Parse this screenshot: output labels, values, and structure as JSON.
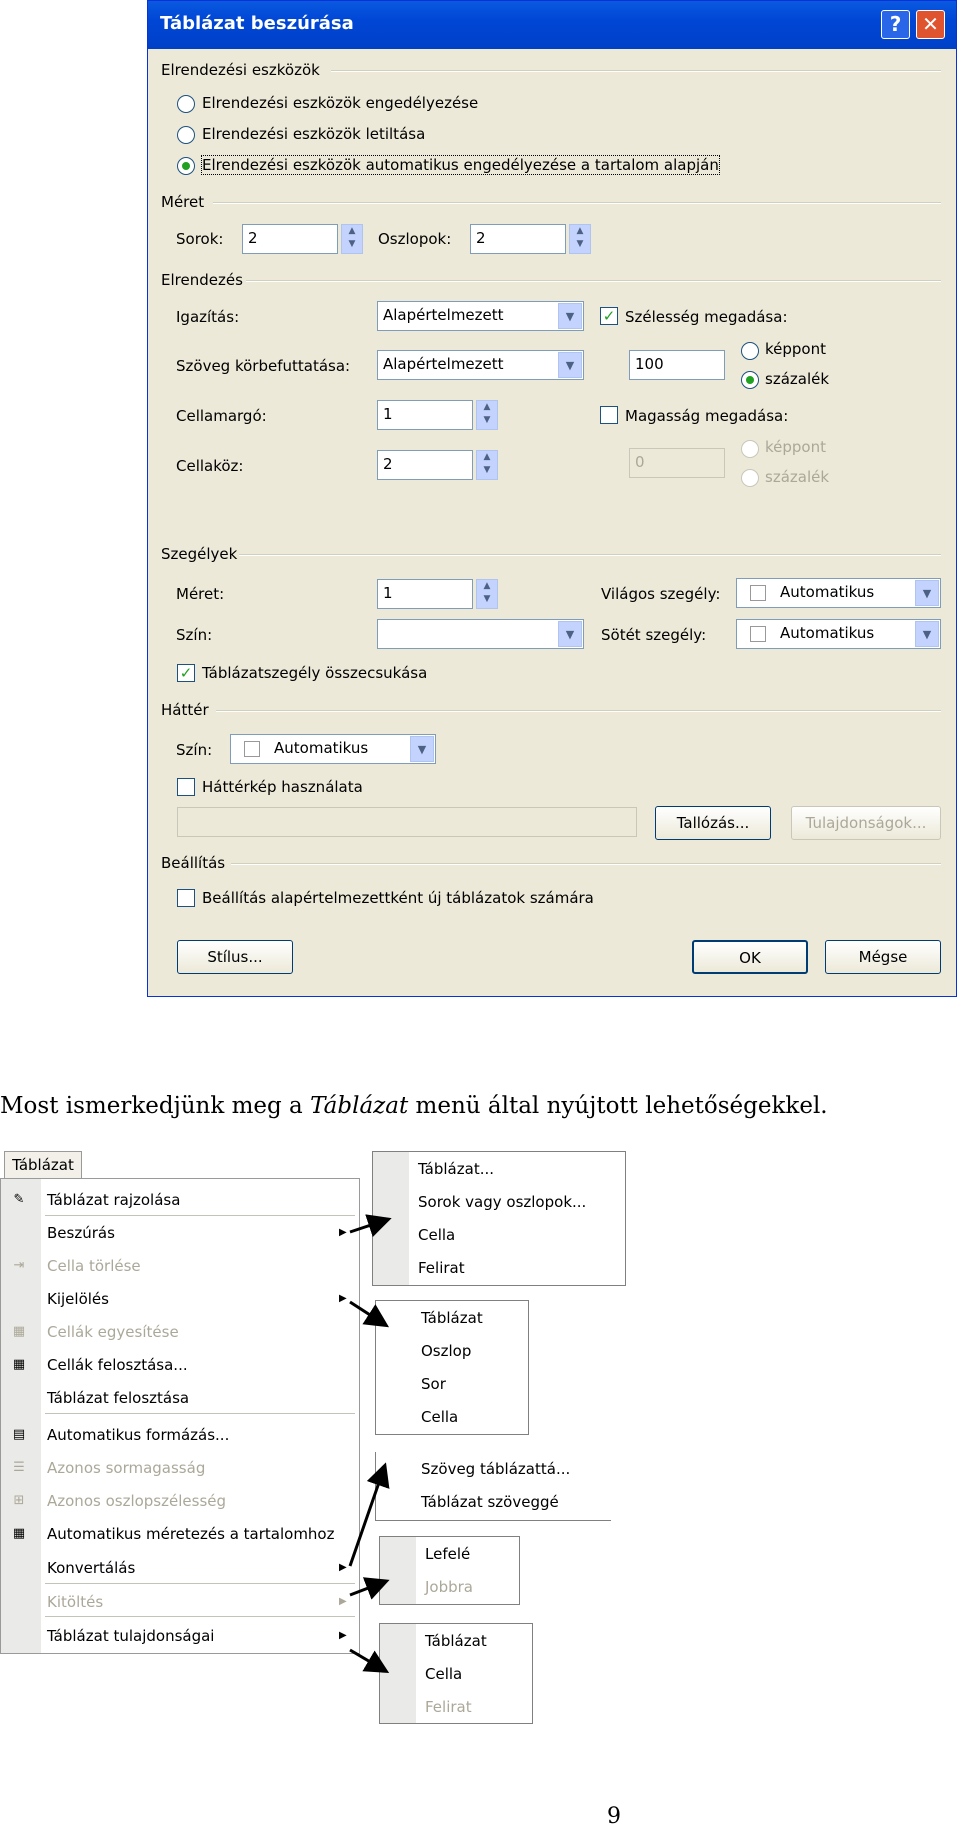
{
  "dialog": {
    "title": "Táblázat beszúrása",
    "help": "?",
    "close": "✕",
    "layout_tools": {
      "heading": "Elrendezési eszközök",
      "options": [
        "Elrendezési eszközök engedélyezése",
        "Elrendezési eszközök letiltása",
        "Elrendezési eszközök automatikus engedélyezése a tartalom alapján"
      ],
      "selected": 2
    },
    "size": {
      "heading": "Méret",
      "rows_label": "Sorok:",
      "rows_value": "2",
      "cols_label": "Oszlopok:",
      "cols_value": "2"
    },
    "layout": {
      "heading": "Elrendezés",
      "align_label": "Igazítás:",
      "align_value": "Alapértelmezett",
      "wrap_label": "Szöveg körbefuttatása:",
      "wrap_value": "Alapértelmezett",
      "padding_label": "Cellamargó:",
      "padding_value": "1",
      "spacing_label": "Cellaköz:",
      "spacing_value": "2",
      "width_label": "Szélesség megadása:",
      "width_checked": true,
      "width_value": "100",
      "width_unit1": "képpont",
      "width_unit2": "százalék",
      "width_unit_selected": 2,
      "height_label": "Magasság megadása:",
      "height_checked": false,
      "height_value": "0",
      "height_unit1": "képpont",
      "height_unit2": "százalék"
    },
    "borders": {
      "heading": "Szegélyek",
      "size_label": "Méret:",
      "size_value": "1",
      "color_label": "Szín:",
      "color_value": "",
      "light_label": "Világos szegély:",
      "light_value": "Automatikus",
      "dark_label": "Sötét szegély:",
      "dark_value": "Automatikus",
      "collapse_label": "Táblázatszegély összecsukása",
      "collapse_checked": true
    },
    "background": {
      "heading": "Háttér",
      "color_label": "Szín:",
      "color_value": "Automatikus",
      "image_label": "Háttérkép használata",
      "image_checked": false,
      "path_value": "",
      "browse": "Tallózás...",
      "properties": "Tulajdonságok..."
    },
    "settings": {
      "heading": "Beállítás",
      "default_label": "Beállítás alapértelmezettként új táblázatok számára",
      "default_checked": false
    },
    "style_btn": "Stílus...",
    "ok_btn": "OK",
    "cancel_btn": "Mégse"
  },
  "caption": {
    "before": "Most ismerkedjünk meg a ",
    "italic": "Táblázat",
    "after": " menü által nyújtott lehetőségekkel."
  },
  "menu": {
    "title": "Táblázat",
    "items": [
      {
        "label": "Táblázat rajzolása",
        "icon": "pencil-icon",
        "glyph": "✎",
        "disabled": false,
        "sub": false
      },
      {
        "label": "Beszúrás",
        "icon": "",
        "glyph": "",
        "disabled": false,
        "sub": true
      },
      {
        "label": "Cella törlése",
        "icon": "delete-cells-icon",
        "glyph": "⇥",
        "disabled": true,
        "sub": false
      },
      {
        "label": "Kijelölés",
        "icon": "",
        "glyph": "",
        "disabled": false,
        "sub": true
      },
      {
        "label": "Cellák egyesítése",
        "icon": "merge-cells-icon",
        "glyph": "▦",
        "disabled": true,
        "sub": false
      },
      {
        "label": "Cellák felosztása...",
        "icon": "split-cells-icon",
        "glyph": "▦",
        "disabled": false,
        "sub": false
      },
      {
        "label": "Táblázat felosztása",
        "icon": "",
        "glyph": "",
        "disabled": false,
        "sub": false
      },
      {
        "label": "Automatikus formázás...",
        "icon": "autoformat-icon",
        "glyph": "▤",
        "disabled": false,
        "sub": false
      },
      {
        "label": "Azonos sormagasság",
        "icon": "distribute-rows-icon",
        "glyph": "☰",
        "disabled": true,
        "sub": false
      },
      {
        "label": "Azonos oszlopszélesség",
        "icon": "distribute-cols-icon",
        "glyph": "⊞",
        "disabled": true,
        "sub": false
      },
      {
        "label": "Automatikus méretezés a tartalomhoz",
        "icon": "autofit-icon",
        "glyph": "▦",
        "disabled": false,
        "sub": false
      },
      {
        "label": "Konvertálás",
        "icon": "",
        "glyph": "",
        "disabled": false,
        "sub": true
      },
      {
        "label": "Kitöltés",
        "icon": "",
        "glyph": "",
        "disabled": true,
        "sub": true
      },
      {
        "label": "Táblázat tulajdonságai",
        "icon": "",
        "glyph": "",
        "disabled": false,
        "sub": true
      }
    ]
  },
  "submenus": {
    "insert": [
      "Táblázat...",
      "Sorok vagy oszlopok...",
      "Cella",
      "Felirat"
    ],
    "select": [
      "Táblázat",
      "Oszlop",
      "Sor",
      "Cella"
    ],
    "convert": [
      "Szöveg táblázattá...",
      "Táblázat szöveggé"
    ],
    "fill": [
      "Lefelé",
      "Jobbra"
    ],
    "properties": [
      "Táblázat",
      "Cella",
      "Felirat"
    ]
  },
  "page_number": "9"
}
